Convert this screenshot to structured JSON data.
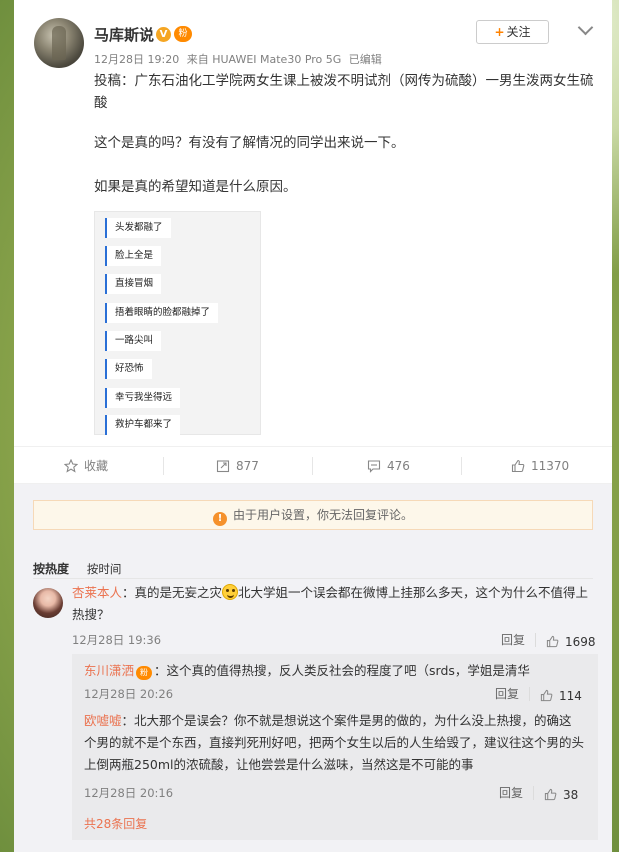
{
  "post": {
    "username": "马库斯说",
    "verified_badge": "V",
    "fan_badge": "粉",
    "date": "12月28日 19:20",
    "source": "来自 HUAWEI Mate30 Pro 5G",
    "edited": "已编辑",
    "follow_label": "关注",
    "follow_plus": "+",
    "text_line1": "投稿：广东石油化工学院两女生课上被泼不明试剂（网传为硫酸）一男生泼两女生硫酸",
    "text_line2": "这个是真的吗？有没有了解情况的同学出来说一下。",
    "text_line3": "如果是真的希望知道是什么原因。",
    "image_bubbles": [
      "头发都融了",
      "脸上全是",
      "直接冒烟",
      "捂着眼睛的脸都融掉了",
      "一路尖叫",
      "好恐怖",
      "幸亏我坐得远",
      "救护车都来了"
    ]
  },
  "actions": {
    "favorite_label": "收藏",
    "repost_count": "877",
    "comment_count": "476",
    "like_count": "11370"
  },
  "notice": {
    "icon": "!",
    "text": "由于用户设置，你无法回复评论。"
  },
  "sort": {
    "hot_label": "按热度",
    "time_label": "按时间"
  },
  "comment": {
    "username": "杏莱本人",
    "text_a": "：真的是无妄之灾",
    "text_b": "北大学姐一个误会都在微博上挂那么多天，这个为什么不值得上热搜？",
    "time": "12月28日 19:36",
    "reply_label": "回复",
    "likes": "1698"
  },
  "replies": [
    {
      "username": "东川潇洒",
      "badge": "粉",
      "text": "：这个真的值得热搜，反人类反社会的程度了吧（srds，学姐是清华",
      "time": "12月28日 20:26",
      "reply_label": "回复",
      "likes": "114"
    },
    {
      "username": "欧嘘嘘",
      "text": "：北大那个是误会？你不就是想说这个案件是男的做的，为什么没上热搜，的确这个男的就不是个东西，直接判死刑好吧，把两个女生以后的人生给毁了，建议往这个男的头上倒两瓶250ml的浓硫酸，让他尝尝是什么滋味，当然这是不可能的事",
      "time": "12月28日 20:16",
      "reply_label": "回复",
      "likes": "38"
    }
  ],
  "more_replies": "共28条回复",
  "colors": {
    "link": "#eb7350",
    "accent": "#ff8200",
    "notice_bg": "#fdf7ea"
  }
}
